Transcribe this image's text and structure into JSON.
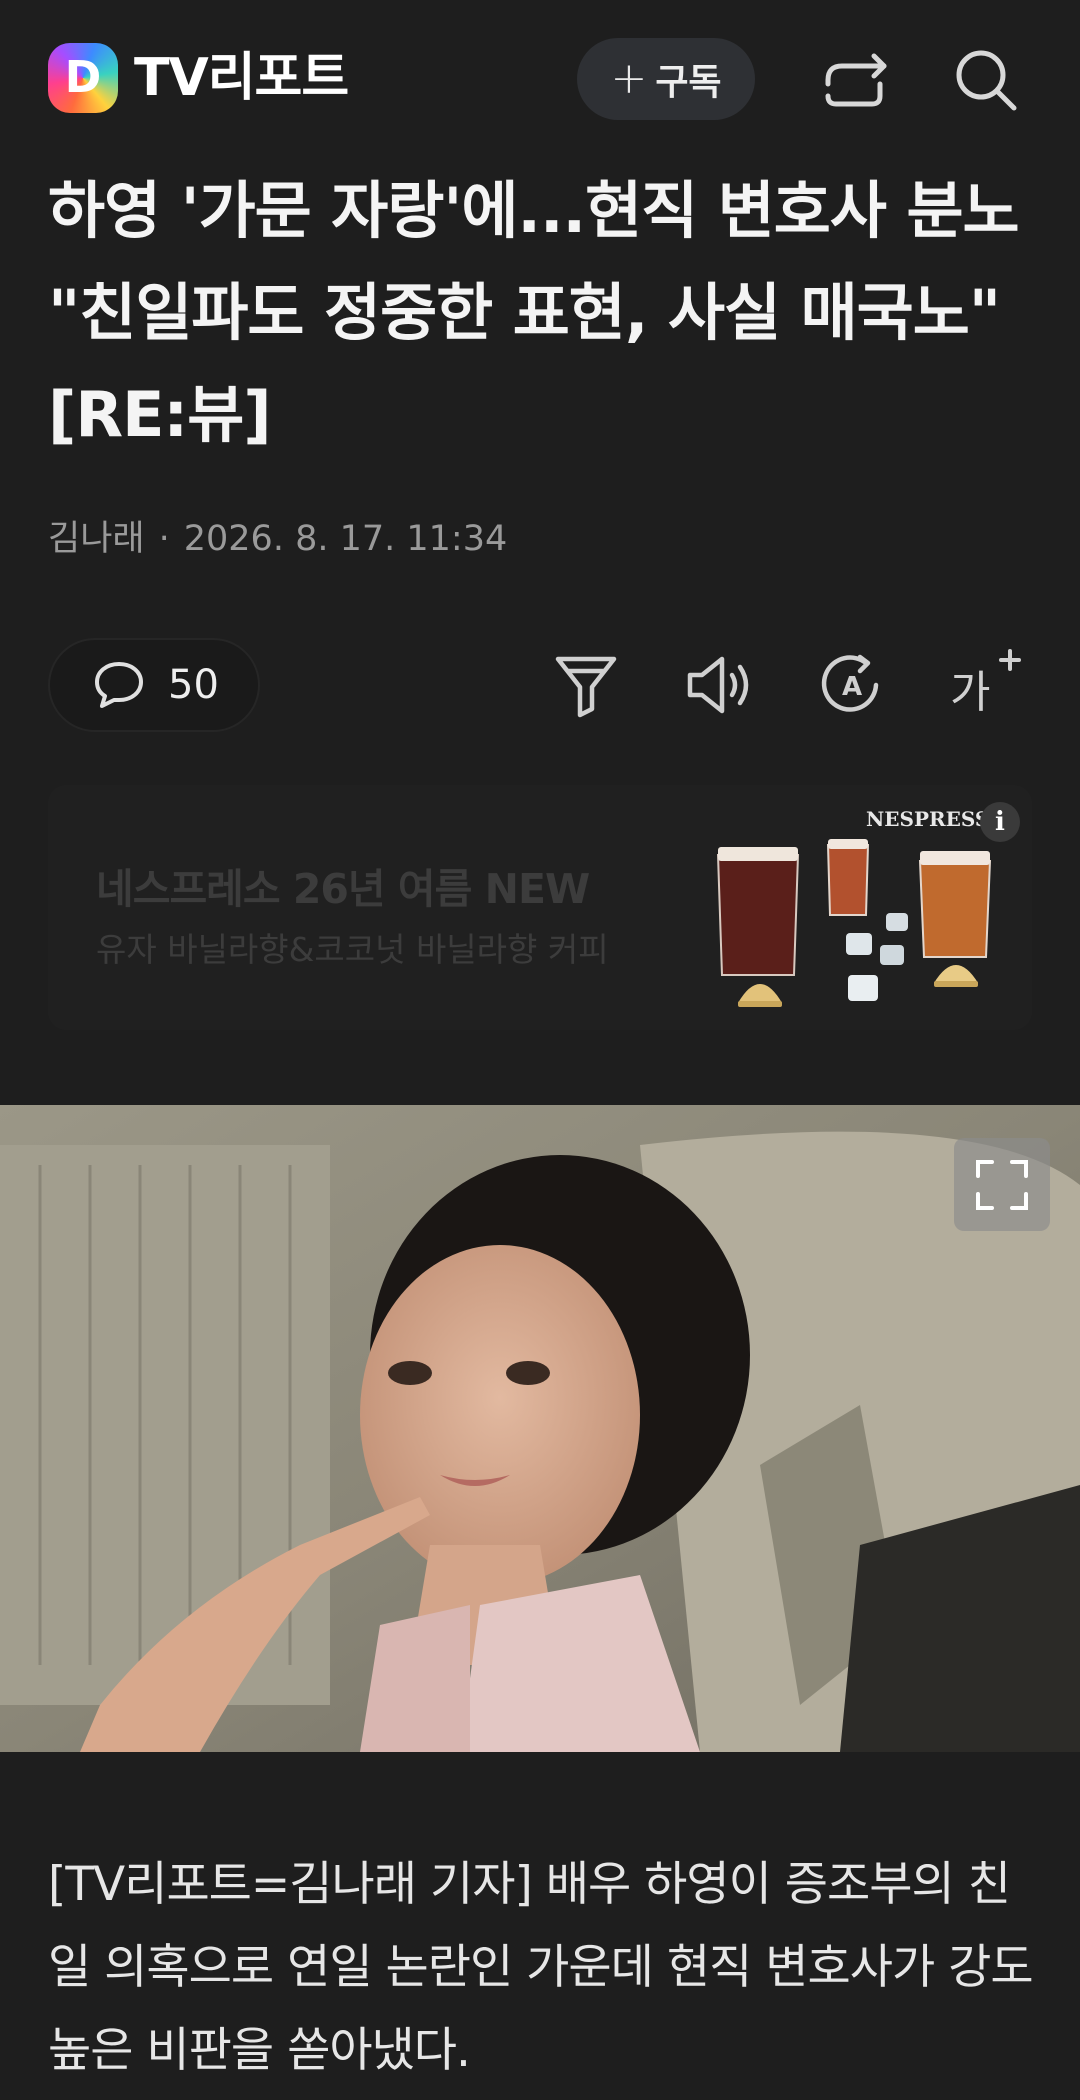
{
  "header": {
    "logo_letter": "D",
    "brand": "TV리포트",
    "subscribe_label": "구독",
    "icons": [
      "share-icon",
      "search-icon"
    ]
  },
  "article": {
    "title": "하영 '가문 자랑'에...현직 변호사 분노 \"친일파도 정중한 표현, 사실 매국노\" [RE:뷰]",
    "author": "김나래",
    "separator": "·",
    "date": "2026. 8. 17. 11:34"
  },
  "toolbar": {
    "comment_count": "50",
    "icons": [
      "comment-icon",
      "filter-icon",
      "speaker-icon",
      "translate-icon",
      "font-size-icon"
    ]
  },
  "ad": {
    "title": "네스프레소 26년 여름 NEW",
    "subtitle": "유자 바닐라향&코코넛 바닐라향 커피",
    "brand": "NESPRESSO",
    "info_icon": "i"
  },
  "photo": {
    "expand_icon": "expand-icon"
  },
  "body": {
    "paragraph": "[TV리포트=김나래 기자] 배우 하영이 증조부의 친일 의혹으로 연일 논란인 가운데 현직 변호사가 강도 높은 비판을 쏟아냈다."
  },
  "colors": {
    "background": "#1e1e1e",
    "subscribe_bg": "#2e3034",
    "meta_text": "#9a9a9a"
  }
}
